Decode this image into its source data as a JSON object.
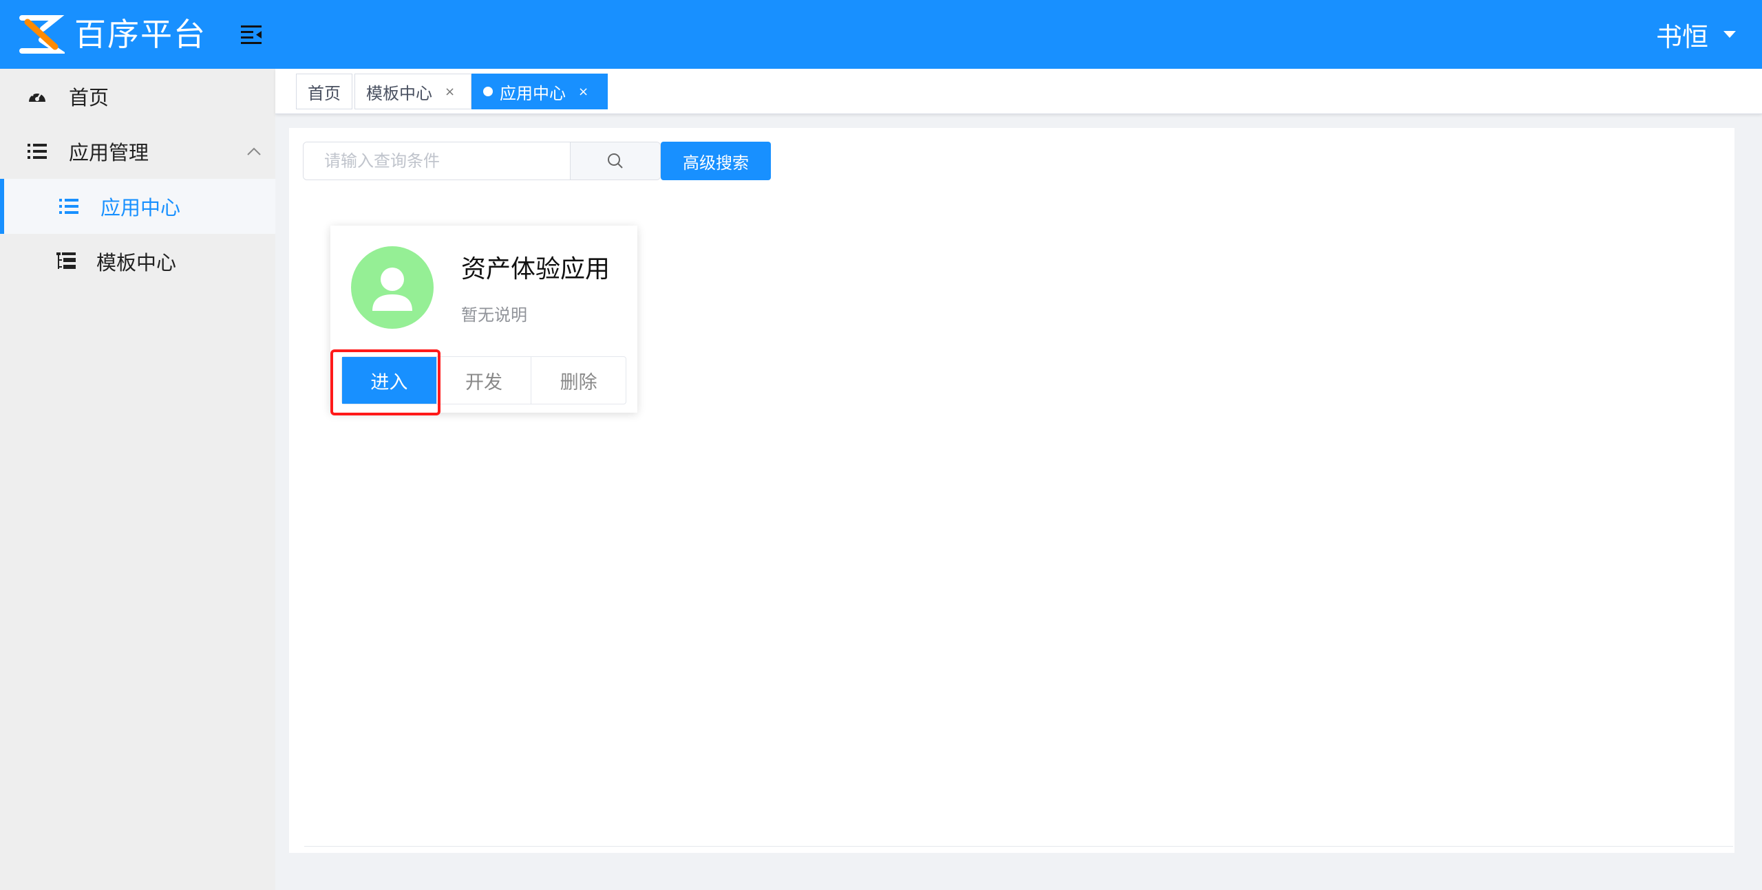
{
  "header": {
    "brand": "百序平台",
    "user": "书恒",
    "brand_color": "#1890ff"
  },
  "sidebar": {
    "items": [
      {
        "label": "首页",
        "icon": "dashboard-icon"
      },
      {
        "label": "应用管理",
        "icon": "list-icon"
      },
      {
        "label": "应用中心",
        "icon": "list-icon",
        "active": true
      },
      {
        "label": "模板中心",
        "icon": "tree-table-icon"
      }
    ]
  },
  "tabs": [
    {
      "label": "首页"
    },
    {
      "label": "模板中心",
      "close": "×"
    },
    {
      "label": "应用中心",
      "close": "×",
      "active": true
    }
  ],
  "search": {
    "placeholder": "请输入查询条件",
    "advanced_label": "高级搜索"
  },
  "apps": [
    {
      "title": "资产体验应用",
      "description": "暂无说明",
      "actions": {
        "enter": "进入",
        "develop": "开发",
        "delete": "删除"
      }
    }
  ],
  "colors": {
    "accent": "#1890ff",
    "avatar": "#95ef95",
    "highlight": "#ff1a1a"
  }
}
